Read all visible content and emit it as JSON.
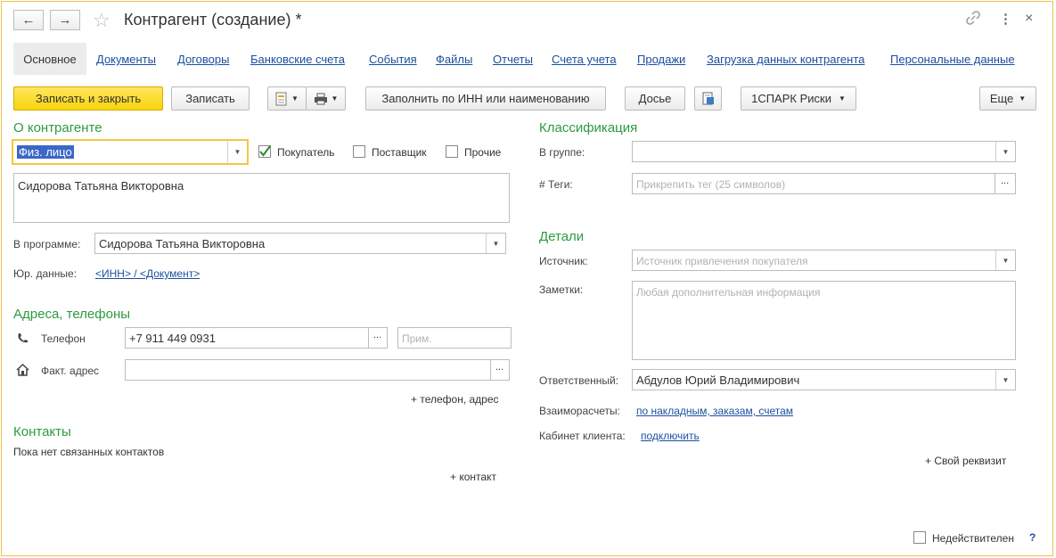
{
  "window": {
    "title": "Контрагент (создание) *",
    "back_icon": "←",
    "forward_icon": "→",
    "star_icon": "☆",
    "link_icon": "🔗",
    "more_icon": "⋮",
    "close_icon": "×"
  },
  "tabs": {
    "active": "Основное",
    "links": [
      "Документы",
      "Договоры",
      "Банковские счета",
      "События",
      "Файлы",
      "Отчеты",
      "Счета учета",
      "Продажи",
      "Загрузка данных контрагента",
      "Персональные данные"
    ]
  },
  "toolbar": {
    "save_close": "Записать и закрыть",
    "save": "Записать",
    "fill_inn": "Заполнить по ИНН или наименованию",
    "dossier": "Досье",
    "spark": "1СПАРК Риски",
    "more": "Еще"
  },
  "about": {
    "header": "О контрагенте",
    "type_value": "Физ. лицо",
    "buyer_label": "Покупатель",
    "buyer_checked": true,
    "supplier_label": "Поставщик",
    "other_label": "Прочие",
    "full_name": "Сидорова Татьяна Викторовна",
    "in_program_label": "В программе:",
    "in_program_value": "Сидорова Татьяна Викторовна",
    "legal_label": "Юр. данные:",
    "legal_link": "<ИНН> / <Документ>"
  },
  "addresses": {
    "header": "Адреса, телефоны",
    "phone_label": "Телефон",
    "phone_value": "+7 911 449 0931",
    "phone_note_placeholder": "Прим.",
    "address_label": "Факт. адрес",
    "add_link": "+ телефон, адрес"
  },
  "contacts": {
    "header": "Контакты",
    "empty_text": "Пока нет связанных контактов",
    "add_link": "+ контакт"
  },
  "classification": {
    "header": "Классификация",
    "group_label": "В группе:",
    "tags_label": "#  Теги:",
    "tags_placeholder": "Прикрепить тег (25 символов)"
  },
  "details": {
    "header": "Детали",
    "source_label": "Источник:",
    "source_placeholder": "Источник привлечения покупателя",
    "notes_label": "Заметки:",
    "notes_placeholder": "Любая дополнительная информация",
    "responsible_label": "Ответственный:",
    "responsible_value": "Абдулов Юрий Владимирович",
    "settlements_label": "Взаиморасчеты:",
    "settlements_link": "по накладным, заказам, счетам",
    "cabinet_label": "Кабинет клиента:",
    "cabinet_link": "подключить",
    "own_attr": "+ Свой реквизит"
  },
  "footer": {
    "invalid_label": "Недействителен",
    "help_icon": "?"
  }
}
